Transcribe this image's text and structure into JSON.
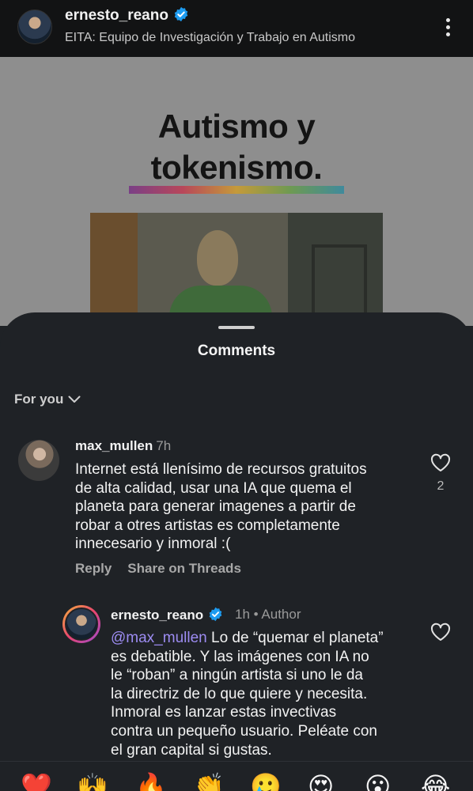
{
  "header": {
    "username": "ernesto_reano",
    "subtitle": "EITA: Equipo de Investigación y Trabajo en Autismo"
  },
  "post": {
    "title_line1": "Autismo y",
    "title_line2": "tokenismo."
  },
  "sheet": {
    "title": "Comments",
    "filter_label": "For you"
  },
  "comments": [
    {
      "username": "max_mullen",
      "time": "7h",
      "lines": [
        "Internet está llenísimo de recursos gratuitos",
        "de alta calidad, usar una IA que quema el",
        "planeta para generar imagenes a partir de",
        "robar a otres artistas es completamente",
        "innecesario y inmoral :("
      ],
      "like_count": "2",
      "reply_label": "Reply",
      "share_label": "Share on Threads"
    },
    {
      "username": "ernesto_reano",
      "time": "1h",
      "separator": "•",
      "role": "Author",
      "mention": "@max_mullen",
      "line1_rest": " Lo de “quemar el planeta”",
      "lines": [
        "es debatible. Y las imágenes con IA no",
        "le “roban” a ningún artista si uno le da",
        "la directriz de lo que quiere y necesita.",
        "Inmoral es lanzar estas invectivas",
        "contra un pequeño usuario. Peléate con",
        "el gran capital si gustas."
      ]
    }
  ],
  "emoji_bar": [
    "❤️",
    "🙌",
    "🔥",
    "👏",
    "🥲",
    "😍",
    "😮",
    "😂"
  ],
  "colors": {
    "background": "#1f2226",
    "verified": "#1d9bf0",
    "mention": "#9d8cf2"
  }
}
